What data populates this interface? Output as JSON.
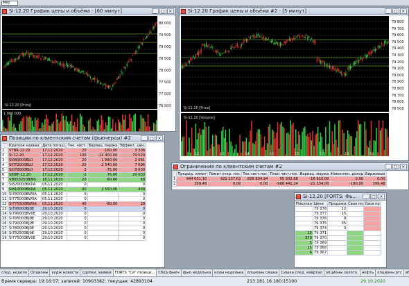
{
  "topbar": {
    "combo": "Мео"
  },
  "chart1": {
    "title": "Si-12.20 График цены и объёма - [60 минут]",
    "price_ticks": [
      "80 000",
      "79 500",
      "79 000",
      "78 500",
      "78 000",
      "77 500",
      "77 000",
      "76 500"
    ],
    "series_label": "Si-12.20 [Price]",
    "vol_ticks": [
      "1 000 000",
      "500 000"
    ],
    "right_tags": [
      "79 500",
      "78 500",
      "77 500"
    ]
  },
  "chart2": {
    "title": "Si-12.20 График цены и объёма #2 - [5 минут]",
    "price_ticks": [
      "79 800",
      "79 700",
      "79 600",
      "79 500",
      "79 400",
      "79 300",
      "79 200",
      "79 100",
      "79 000",
      "78 900",
      "78 800",
      "78 700",
      "78 600",
      "78 500"
    ],
    "series_label": "Si-12.20 [Price]",
    "vol_label": "Si-12.20 [Volume]",
    "vol_ticks": [
      "300 000",
      "200 000",
      "100 000"
    ],
    "time_ticks": [
      "12",
      "13",
      "14",
      "15",
      "16",
      "17",
      "18",
      "19"
    ],
    "date_tag": "30/10"
  },
  "positions": {
    "title": "Позиции по клиентским счетам (фьючерсы) #2",
    "headers": [
      "",
      "Краткое назван.",
      "Дата погаш.",
      "Тек. чист.",
      "Вариац. маржа",
      "Эффект. цен."
    ],
    "rows": [
      [
        "1",
        "VTBR-12.20",
        "17.12.2020",
        "20",
        "-160,00",
        "3 306",
        "r"
      ],
      [
        "2",
        "Si-12.20",
        "17.12.2020",
        "100",
        "-14 400,00",
        "79 529",
        "r"
      ],
      [
        "3",
        "Si080000BL0",
        "17.12.2020",
        "20",
        "-1 660,00",
        "2 081",
        "r"
      ],
      [
        "4",
        "Si072000BL0",
        "17.12.2020",
        "20",
        "-2 540,00",
        "7 696",
        "r"
      ],
      [
        "5",
        "Si070000BL0",
        "17.12.2020",
        "2",
        "-75,00",
        "9 600",
        "r"
      ],
      [
        "6",
        "SiB8F-12.20",
        "17.12.2020",
        "-2",
        "76,00",
        "20 633",
        "g"
      ],
      [
        "7",
        "VB003250BW0",
        "18.11.2020",
        "20",
        "60,00",
        "68",
        "g"
      ],
      [
        "8",
        "Si820000BK0A",
        "05.11.2020",
        "0",
        "",
        "0",
        ""
      ],
      [
        "9",
        "Si810000BK0A",
        "05.11.2020",
        "-30",
        "2 550,00",
        "409",
        "g"
      ],
      [
        "10",
        "Si780000BW0A",
        "05.11.2020",
        "0",
        "",
        "0",
        ""
      ],
      [
        "11",
        "Si775000BW0A",
        "05.11.2020",
        "0",
        "",
        "0",
        ""
      ],
      [
        "12",
        "Si775500BW0A",
        "05.11.2020",
        "40",
        "-80,00",
        "28",
        "r"
      ],
      [
        "13",
        "Si795000BJ0E",
        "29.10.2020",
        "0",
        "",
        "0",
        "b"
      ],
      [
        "14",
        "Si790000BV0E",
        "29.10.2020",
        "0",
        "",
        "0",
        ""
      ],
      [
        "15",
        "Si785000BJ0E",
        "29.10.2020",
        "0",
        "",
        "0",
        ""
      ],
      [
        "16",
        "Si790000BJ0E",
        "29.10.2020",
        "0",
        "",
        "0",
        ""
      ],
      [
        "17",
        "Si780000BJ0E",
        "29.10.2020",
        "0",
        "",
        "0",
        ""
      ],
      [
        "18",
        "Si782500BJ0E",
        "29.10.2020",
        "0",
        "",
        "0",
        ""
      ],
      [
        "19",
        "Si775000BV0E",
        "29.10.2020",
        "0",
        "",
        "0",
        ""
      ]
    ]
  },
  "limits": {
    "title": "Ограничения по клиентским счетам #2",
    "headers": [
      "",
      "Предыд. лимит",
      "Лимит откр. поз.",
      "Тек.чист.поз.",
      "План.чист.поз.",
      "Вариац. маржа",
      "Накоплен. доход",
      "Биржевые"
    ],
    "rows": [
      [
        "1",
        "944 051,10",
        "922 137,62",
        "826 834,94",
        "95 302,68",
        "-16 910,00",
        "0,00",
        "0,00",
        "r"
      ],
      [
        "2",
        "399,48",
        "0,00",
        "0,00",
        "-968 441,24",
        "-21 334,00",
        "-180,00",
        "399,48",
        "r"
      ]
    ]
  },
  "orderbook": {
    "title": "Si-12.20 [FORTS: Фь...",
    "headers": [
      "Покупка",
      "Цена",
      "Продажа",
      "Своя по",
      "Своя пр"
    ],
    "rows": [
      [
        "",
        "79 378",
        "12",
        "",
        ""
      ],
      [
        "",
        "79 377",
        "15",
        "",
        ""
      ],
      [
        "",
        "79 376",
        "9",
        "",
        ""
      ],
      [
        "",
        "79 375",
        "35",
        "",
        ""
      ],
      [
        "",
        "79 374",
        "3",
        "",
        ""
      ],
      [
        "15",
        "79 371",
        "",
        "",
        ""
      ],
      [
        "370",
        "79 370",
        "",
        "",
        ""
      ],
      [
        "5",
        "79 369",
        "",
        "",
        ""
      ],
      [
        "15",
        "79 368",
        "",
        "",
        ""
      ],
      [
        "6",
        "79 367",
        "",
        "",
        ""
      ]
    ]
  },
  "taskbar": {
    "tabs": [
      "след. неделя",
      "Опционы",
      "хедж новости",
      "сделки, заявки",
      "FORTS \"Си\" позици...",
      "Сбер фьюч",
      "фью неделька",
      "колы неделька",
      "опционы сишка",
      "Сишка след. квартал",
      "опционы золото.",
      "нефть",
      "опционы ртс",
      "вбб.."
    ]
  },
  "status": {
    "server_time_label": "Время сервера: 19:16:07; записей: 10903382; текущая: 42893104",
    "ip": "213.181.16.180:15100",
    "date": "29.10.2020"
  }
}
